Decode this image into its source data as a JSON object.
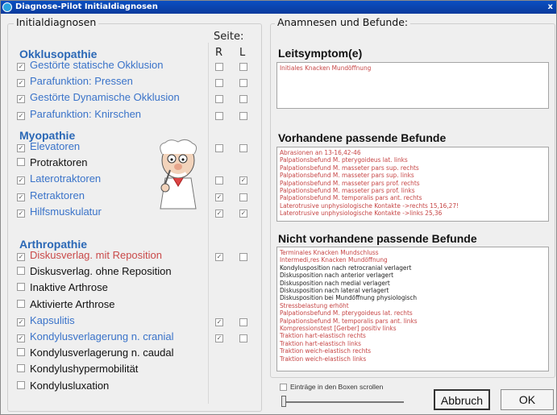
{
  "window": {
    "title": "Diagnose-Pilot Initialdiagnosen",
    "close_label": "x"
  },
  "left": {
    "group_label": "Initialdiagnosen",
    "seite_label": "Seite:",
    "r_label": "R",
    "l_label": "L",
    "sections": [
      {
        "title": "Okklusopathie",
        "items": [
          {
            "label": "Gestörte statische Okklusion",
            "checked": true,
            "color": "blue",
            "r": false,
            "l": false
          },
          {
            "label": "Parafunktion: Pressen",
            "checked": true,
            "color": "blue",
            "r": false,
            "l": false
          },
          {
            "label": "Gestörte Dynamische Okklusion",
            "checked": true,
            "color": "blue",
            "r": false,
            "l": false
          },
          {
            "label": "Parafunktion: Knirschen",
            "checked": true,
            "color": "blue",
            "r": false,
            "l": false
          }
        ]
      },
      {
        "title": "Myopathie",
        "items": [
          {
            "label": "Elevatoren",
            "checked": true,
            "color": "blue",
            "r": false,
            "l": false
          },
          {
            "label": "Protraktoren",
            "checked": false,
            "color": "black",
            "r": null,
            "l": null
          },
          {
            "label": "Laterotraktoren",
            "checked": true,
            "color": "blue",
            "r": false,
            "l": true
          },
          {
            "label": "Retraktoren",
            "checked": true,
            "color": "blue",
            "r": true,
            "l": false
          },
          {
            "label": "Hilfsmuskulatur",
            "checked": true,
            "color": "blue",
            "r": true,
            "l": true
          }
        ]
      },
      {
        "title": "Arthropathie",
        "items": [
          {
            "label": "Diskusverlag. mit Reposition",
            "checked": true,
            "color": "red",
            "r": true,
            "l": false
          },
          {
            "label": "Diskusverlag. ohne Reposition",
            "checked": false,
            "color": "black",
            "r": null,
            "l": null
          },
          {
            "label": "Inaktive Arthrose",
            "checked": false,
            "color": "black",
            "r": null,
            "l": null
          },
          {
            "label": "Aktivierte Arthrose",
            "checked": false,
            "color": "black",
            "r": null,
            "l": null
          },
          {
            "label": "Kapsulitis",
            "checked": true,
            "color": "blue",
            "r": true,
            "l": false
          },
          {
            "label": "Kondylusverlagerung n. cranial",
            "checked": true,
            "color": "blue",
            "r": true,
            "l": false
          },
          {
            "label": "Kondylusverlagerung n. caudal",
            "checked": false,
            "color": "black",
            "r": null,
            "l": null
          },
          {
            "label": "Kondylushypermobilität",
            "checked": false,
            "color": "black",
            "r": null,
            "l": null
          },
          {
            "label": "Kondylusluxation",
            "checked": false,
            "color": "black",
            "r": null,
            "l": null
          }
        ]
      }
    ]
  },
  "right": {
    "group_label": "Anamnesen und Befunde:",
    "leitsymptom_title": "Leitsymptom(e)",
    "leitsymptom_lines": [
      "Initiales Knacken Mundöffnung"
    ],
    "vorhandene_title": "Vorhandene passende Befunde",
    "vorhandene_lines": [
      "Abrasionen an 13-16,42-46",
      "Palpationsbefund M. pterygoideus lat. links",
      "Palpationsbefund M. masseter pars sup. rechts",
      "Palpationsbefund M. masseter pars sup. links",
      "Palpationsbefund M. masseter pars prof. rechts",
      "Palpationsbefund M. masseter pars prof. links",
      "Palpationsbefund M. temporalis pars ant. rechts",
      "Laterotrusive unphysiologische Kontakte ->rechts 15,16,27!",
      "Laterotrusive unphysiologische Kontakte ->links 25,36"
    ],
    "nicht_title": "Nicht vorhandene passende Befunde",
    "nicht_lines": [
      {
        "text": "Terminales Knacken Mundschluss",
        "color": "red"
      },
      {
        "text": "Intermedi,res Knacken Mundöffnung",
        "color": "red"
      },
      {
        "text": "Kondylusposition nach retrocranial verlagert",
        "color": "black"
      },
      {
        "text": "Diskusposition nach anterior verlagert",
        "color": "black"
      },
      {
        "text": "Diskusposition nach medial verlagert",
        "color": "black"
      },
      {
        "text": "Diskusposition nach lateral verlagert",
        "color": "black"
      },
      {
        "text": "Diskusposition bei Mundöffnung physiologisch",
        "color": "black"
      },
      {
        "text": "Stressbelastung erhöht",
        "color": "red"
      },
      {
        "text": "Palpationsbefund M. pterygoideus lat. rechts",
        "color": "red"
      },
      {
        "text": "Palpationsbefund M. temporalis pars ant. links",
        "color": "red"
      },
      {
        "text": "Kompressionstest [Gerber] positiv links",
        "color": "red"
      },
      {
        "text": "Traktion hart-elastisch rechts",
        "color": "red"
      },
      {
        "text": "Traktion hart-elastisch links",
        "color": "red"
      },
      {
        "text": "Traktion weich-elastisch rechts",
        "color": "red"
      },
      {
        "text": "Traktion weich-elastisch links",
        "color": "red"
      }
    ],
    "scroll_checkbox_label": "Einträge in den Boxen scrollen",
    "cancel_button": "Abbruch",
    "ok_button": "OK"
  },
  "colors": {
    "title_bar": "#0a3a9c",
    "section_blue": "#2b68b6",
    "item_blue": "#3a73c9",
    "item_red": "#c94a4a"
  }
}
